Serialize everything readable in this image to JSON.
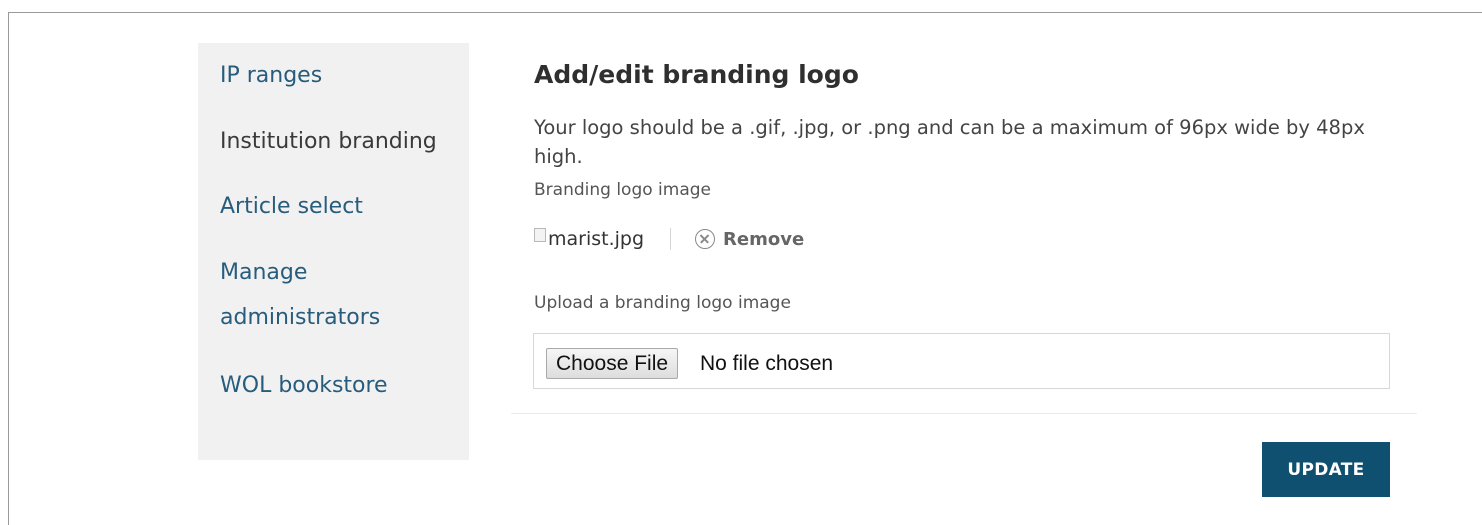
{
  "sidebar": {
    "items": [
      {
        "label": "IP ranges"
      },
      {
        "label": "Institution branding"
      },
      {
        "label": "Article select"
      },
      {
        "label": "Manage"
      },
      {
        "label": "administrators"
      },
      {
        "label": "WOL bookstore"
      }
    ]
  },
  "main": {
    "title": "Add/edit branding logo",
    "description": "Your logo should be a .gif, .jpg, or .png and can be a maximum of 96px wide by 48px high.",
    "current_logo": {
      "label": "Branding logo image",
      "image_alt": "marist.jpg",
      "remove_label": "Remove"
    },
    "upload": {
      "label": "Upload a branding logo image",
      "button_label": "Choose File",
      "status": "No file chosen"
    },
    "update_label": "UPDATE"
  },
  "icons": {
    "broken_image": "broken-image-icon",
    "remove": "circle-x-icon"
  },
  "colors": {
    "link": "#275c7c",
    "sidebar_bg": "#f1f1f1",
    "primary_button": "#0f4f70"
  }
}
